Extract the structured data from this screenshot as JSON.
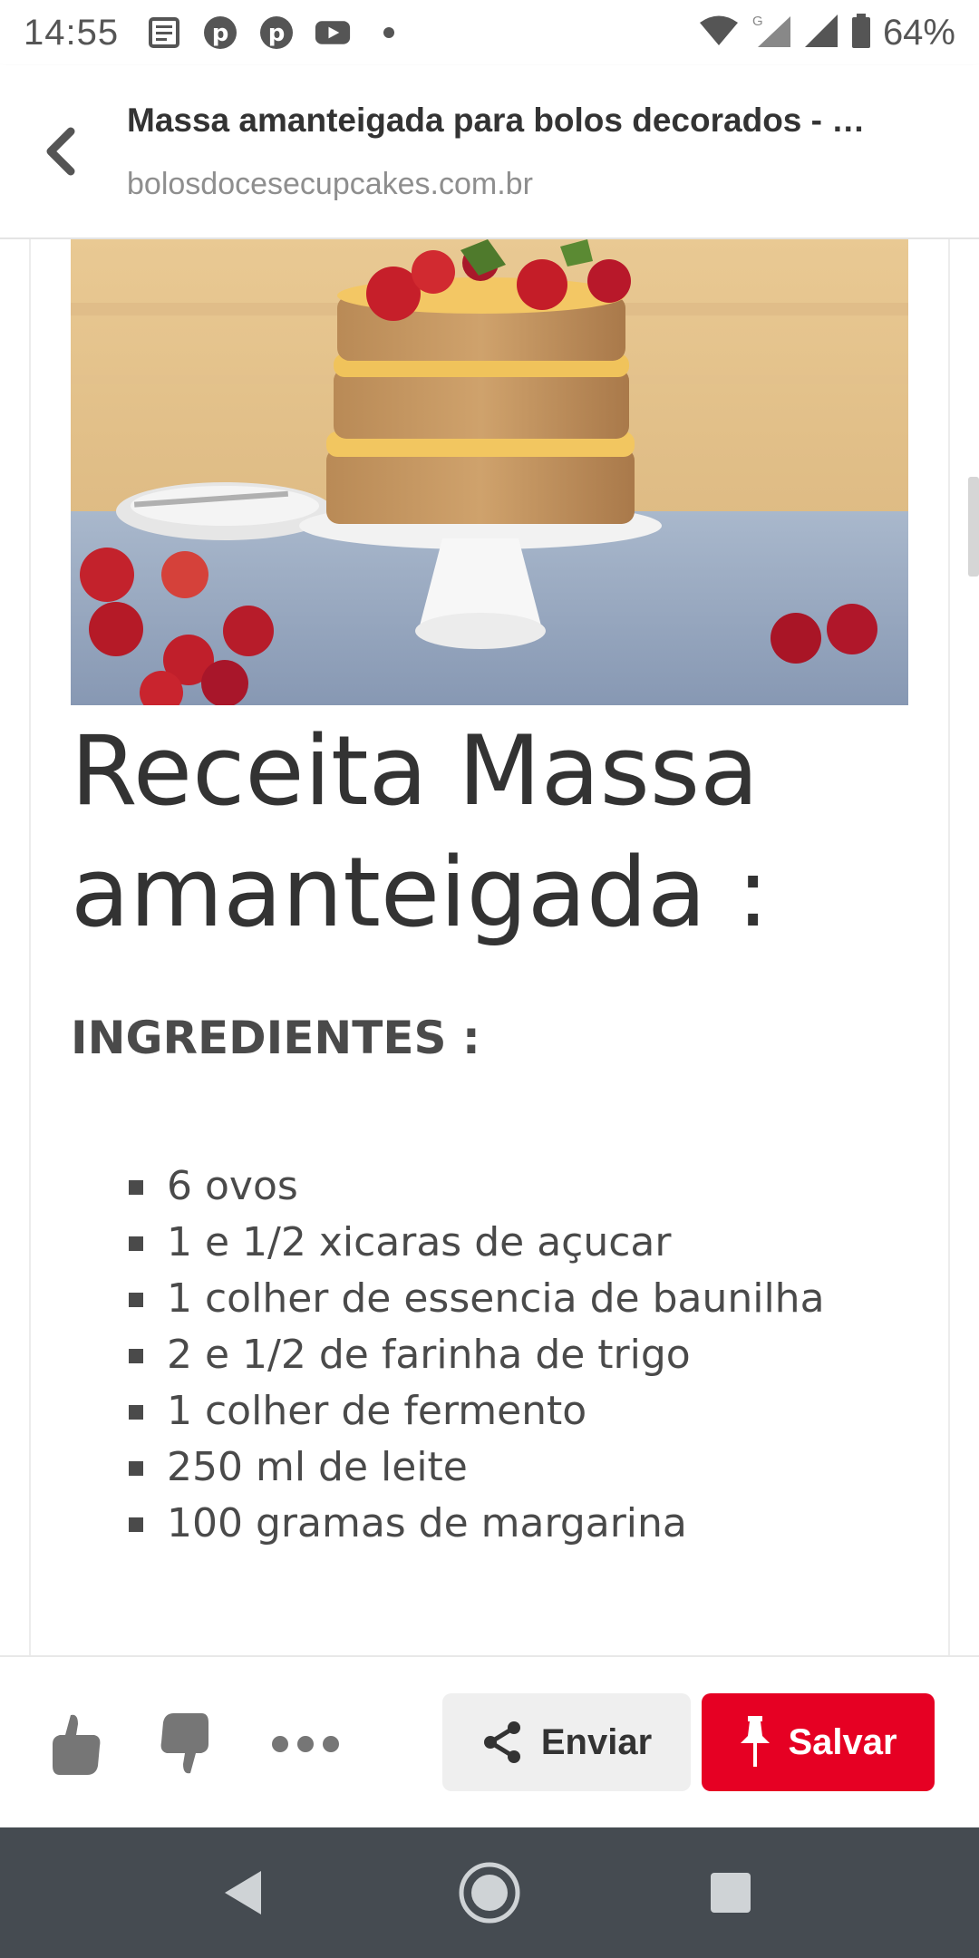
{
  "status_bar": {
    "time": "14:55",
    "battery": "64%",
    "notification_icons": [
      "news-icon",
      "pinterest-icon",
      "pinterest-icon",
      "youtube-icon",
      "dot-icon"
    ],
    "system_icons": [
      "wifi-icon",
      "signal-g-icon",
      "signal-icon",
      "battery-icon"
    ]
  },
  "header": {
    "title": "Massa amanteigada para bolos decorados - …",
    "url": "bolosdocesecupcakes.com.br",
    "back_icon": "chevron-left-icon"
  },
  "content": {
    "image_alt_icon": "cake-photo",
    "recipe_title": "Receita Massa amanteigada :",
    "ingredients_heading": "INGREDIENTES :",
    "ingredients": [
      "6 ovos",
      "1 e 1/2 xicaras de açucar",
      "1 colher de essencia de baunilha",
      "2 e 1/2 de farinha de trigo",
      "1 colher de fermento",
      "250 ml de leite",
      "100 gramas de margarina"
    ]
  },
  "actions": {
    "like_icon": "thumbs-up-icon",
    "dislike_icon": "thumbs-down-icon",
    "more_icon": "more-icon",
    "send_label": "Enviar",
    "send_icon": "share-icon",
    "save_label": "Salvar",
    "save_icon": "pin-icon",
    "save_color": "#e60023"
  },
  "nav": {
    "back_icon": "nav-back-icon",
    "home_icon": "nav-home-icon",
    "recents_icon": "nav-recents-icon"
  }
}
